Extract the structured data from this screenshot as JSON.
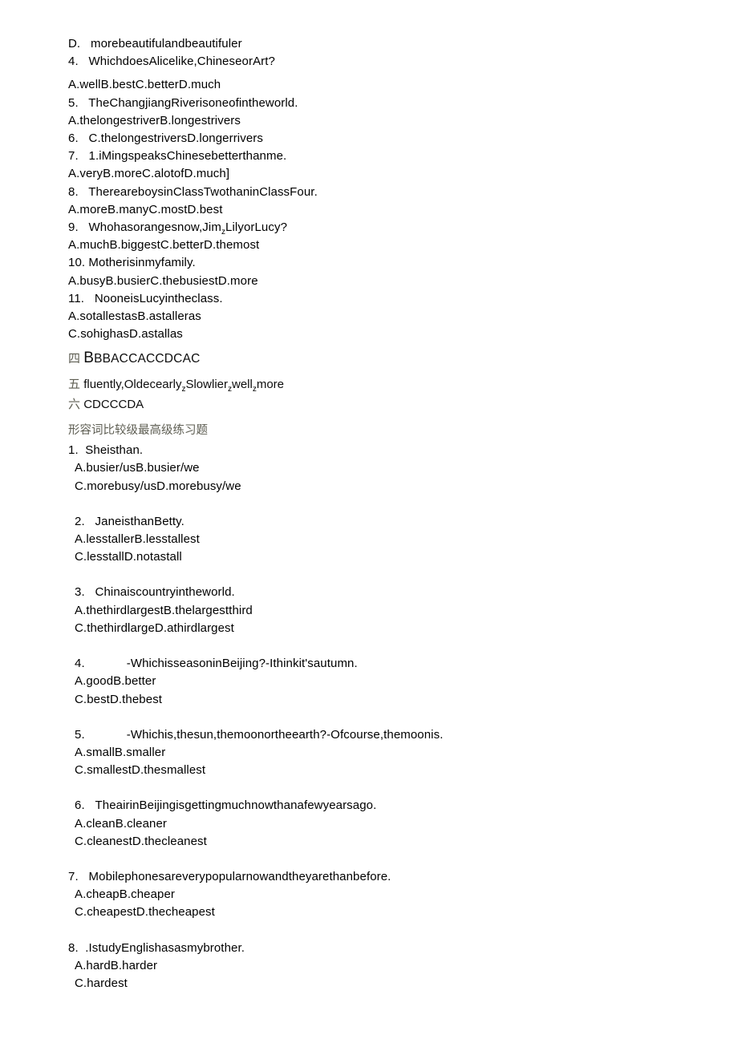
{
  "document": {
    "background_color": "#ffffff",
    "text_color": "#000000",
    "accent_gray": "#5d5d52"
  },
  "section_one": {
    "lines": [
      "D.   morebeautifulandbeautifuler",
      "4.   WhichdoesAlicelike,ChineseorArt?"
    ],
    "after_lines": [
      "A.wellB.bestC.betterD.much",
      "5.   TheChangjiangRiverisoneofintheworld.",
      "A.thelongestriverB.longestrivers",
      "6.   C.thelongestriversD.longerrivers",
      "7.   1.iMingspeaksChinesebetterthanme.",
      "A.veryB.moreC.alotofD.much]",
      "8.   ThereareboysinClassTwothaninClassFour.",
      "A.moreB.manyC.mostD.best"
    ],
    "line_q9_prefix": "9.   Whohasorangesnow,Jim",
    "line_q9_sub": "z",
    "line_q9_suffix": "LilyorLucy?",
    "tail_lines": [
      "A.muchB.biggestC.betterD.themost",
      "10. Motherisinmyfamily.",
      "A.busyB.busierC.thebusiestD.more",
      "11.   NooneisLucyintheclass.",
      "A.sotallestasB.astalleras",
      "C.sohighasD.astallas"
    ]
  },
  "answer_keys": [
    {
      "marker": "四",
      "lead": "B",
      "rest": "BBACCACCDCAC",
      "type": "smallcaps"
    }
  ],
  "answer_key_five": {
    "marker": "五",
    "part1": "fluently,Oldecearly",
    "sub1": "z",
    "part2": "Slowlier",
    "sub2": "z",
    "part3": "well",
    "sub3": "z",
    "part4": "more"
  },
  "answer_key_six": {
    "marker": "六",
    "text": "CDCCCDA"
  },
  "section_two": {
    "heading": "形容词比较级最高级练习题",
    "questions": [
      {
        "number": "1.",
        "stem": "Sheisthan.",
        "stem_indent": 0,
        "options": [
          "A.busier/usB.busier/we",
          "C.morebusy/usD.morebusy/we"
        ],
        "option_indent": 1
      },
      {
        "number": "2.",
        "stem": "JaneisthanBetty.",
        "stem_indent": 1,
        "options": [
          "A.lesstallerB.lesstallest",
          "C.lesstallD.notastall"
        ],
        "option_indent": 1
      },
      {
        "number": "3.",
        "stem": "Chinaiscountryintheworld.",
        "stem_indent": 1,
        "options": [
          "A.thethirdlargestB.thelargestthird",
          "C.thethirdlargeD.athirdlargest"
        ],
        "option_indent": 1
      },
      {
        "number": "4.",
        "stem": "-Whichisseason inBeijing?-Ithinkit'sautumn.",
        "stem_text": "-WhichisseasoninBeijing?-Ithinkit'sautumn.",
        "stem_indent": 1,
        "has_tab": true,
        "options": [
          "A.goodB.better",
          "C.bestD.thebest"
        ],
        "option_indent": 1
      },
      {
        "number": "5.",
        "stem_text": "-Whichis,thesun,themoonortheearth?-Ofcourse,themoonis.",
        "stem_indent": 1,
        "has_tab": true,
        "options": [
          "A.smallB.smaller",
          "C.smallestD.thesmallest"
        ],
        "option_indent": 1
      },
      {
        "number": "6.",
        "stem_text": "TheairinBeijingisgettingmuchnowthanafewyearsago.",
        "stem_indent": 1,
        "has_tab": false,
        "options": [
          "A.cleanB.cleaner",
          "C.cleanestD.thecleanest"
        ],
        "option_indent": 1
      },
      {
        "number": "7.",
        "stem_text": "Mobilephonesareverypopularnowandtheyarethanbefore.",
        "stem_indent": 0,
        "has_tab": false,
        "options": [
          "A.cheapB.cheaper",
          "C.cheapestD.thecheapest"
        ],
        "option_indent": 1
      },
      {
        "number": "8.",
        "stem_text": ".IstudyEnglishasasmybrother.",
        "stem_indent": 0,
        "has_tab": false,
        "options": [
          "A.hardB.harder",
          "C.hardest"
        ],
        "option_indent": 1
      }
    ]
  }
}
